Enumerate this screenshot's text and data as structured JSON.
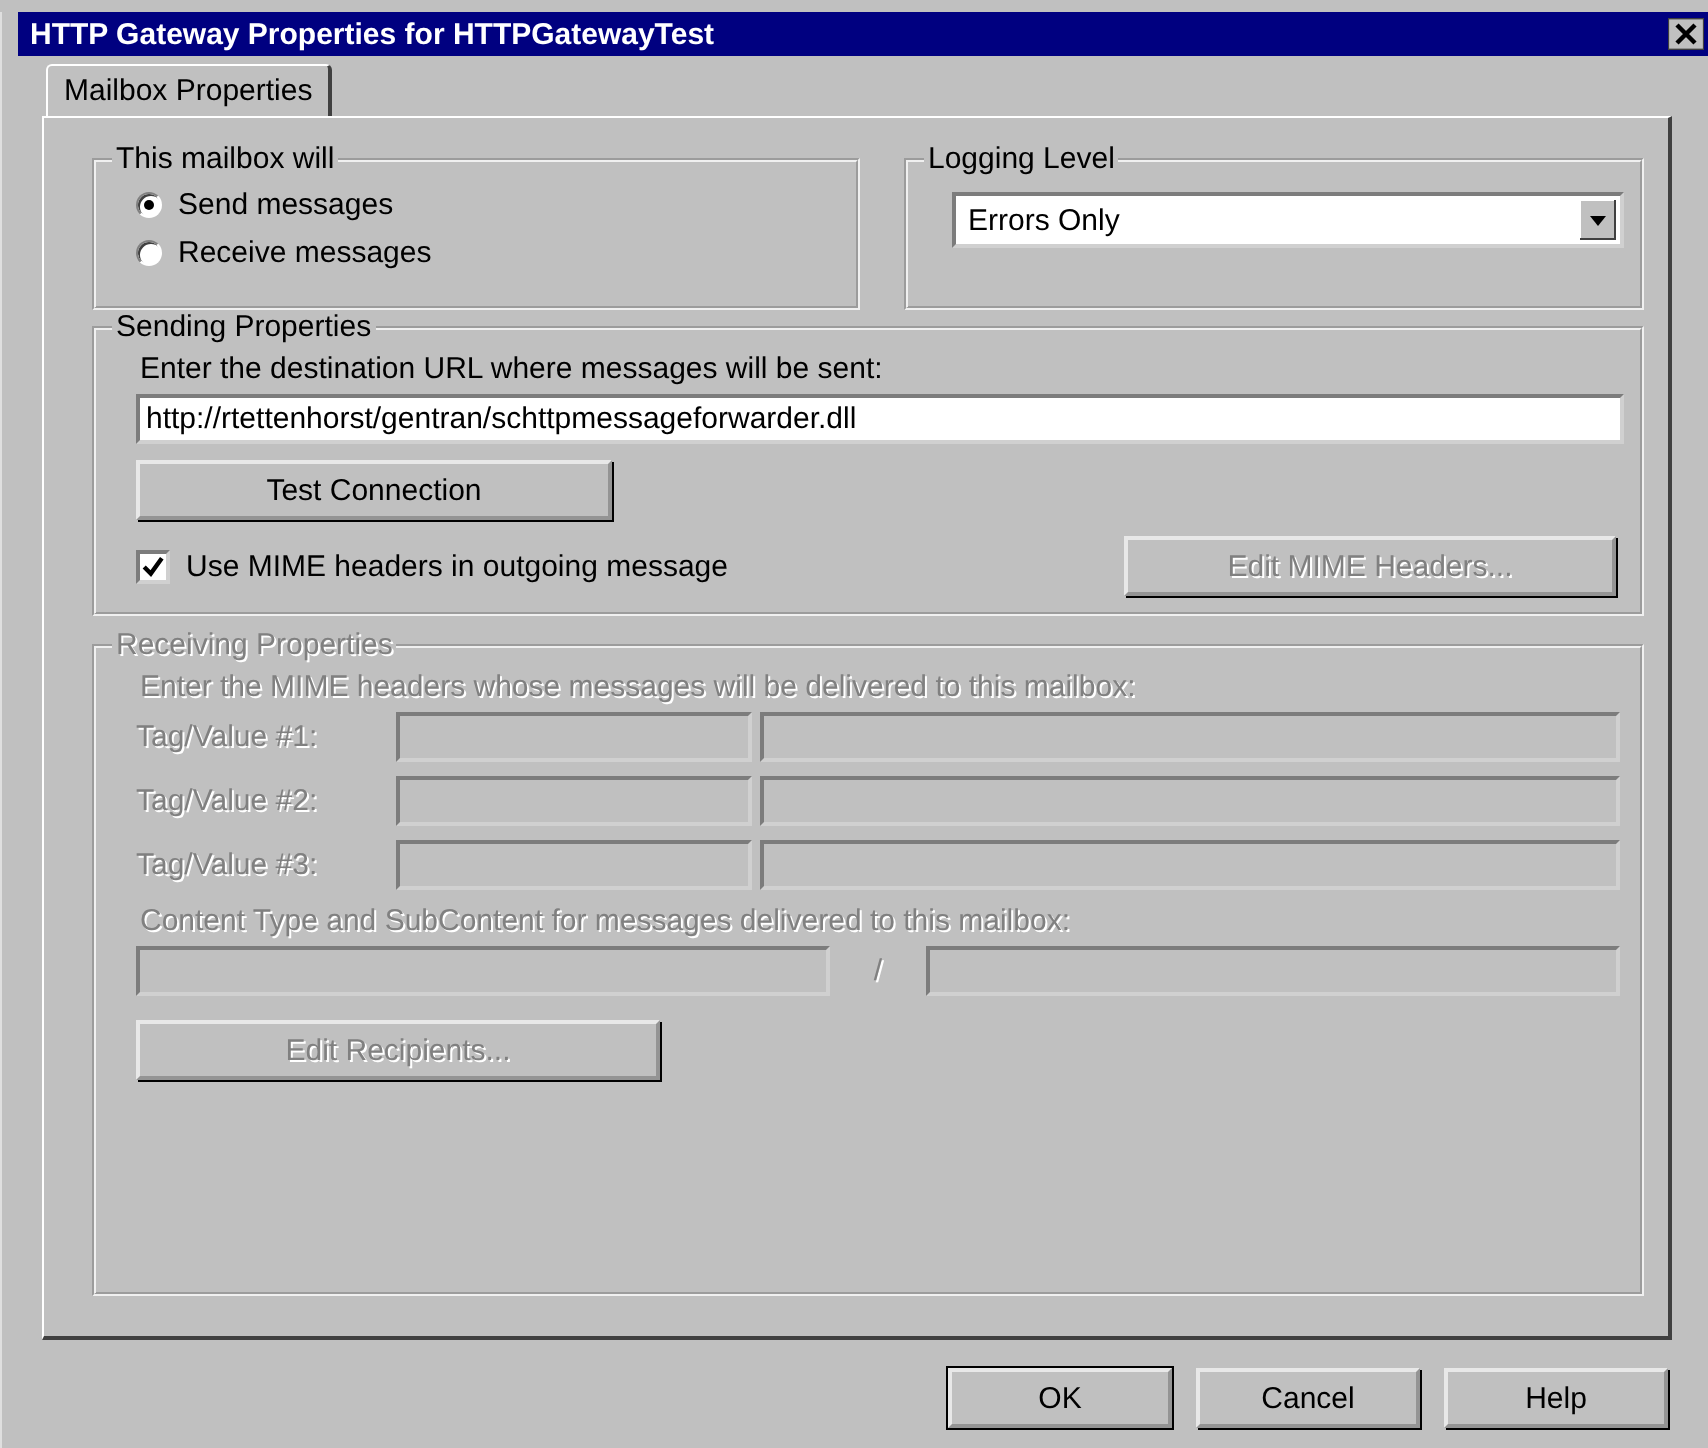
{
  "window": {
    "title": "HTTP Gateway Properties for HTTPGatewayTest"
  },
  "tabs": [
    {
      "label": "Mailbox Properties",
      "selected": true
    }
  ],
  "mailbox_group": {
    "title": "This mailbox will",
    "options": [
      {
        "label": "Send messages",
        "selected": true
      },
      {
        "label": "Receive messages",
        "selected": false
      }
    ]
  },
  "logging_group": {
    "title": "Logging Level",
    "dropdown": {
      "value": "Errors Only"
    }
  },
  "sending": {
    "title": "Sending Properties",
    "disabled": false,
    "url_label": "Enter the destination URL where messages will be sent:",
    "url": {
      "value": "http://rtettenhorst/gentran/schttpmessageforwarder.dll"
    },
    "test_button": {
      "label": "Test Connection",
      "disabled": false
    },
    "use_mime": {
      "label": "Use MIME headers in outgoing message",
      "checked": true
    },
    "edit_mime_button": {
      "label": "Edit MIME Headers...",
      "disabled": true
    }
  },
  "receiving": {
    "title": "Receiving Properties",
    "disabled": true,
    "headers_label": "Enter the MIME headers whose messages will be delivered to this mailbox:",
    "tag_rows": [
      {
        "label": "Tag/Value #1:"
      },
      {
        "label": "Tag/Value #2:"
      },
      {
        "label": "Tag/Value #3:"
      }
    ],
    "content_label": "Content Type and SubContent for messages delivered to this mailbox:",
    "separator": "/",
    "edit_recipients_button": {
      "label": "Edit Recipients..."
    }
  },
  "buttons": [
    {
      "label": "OK",
      "default": true
    },
    {
      "label": "Cancel",
      "default": false
    },
    {
      "label": "Help",
      "default": false
    }
  ]
}
